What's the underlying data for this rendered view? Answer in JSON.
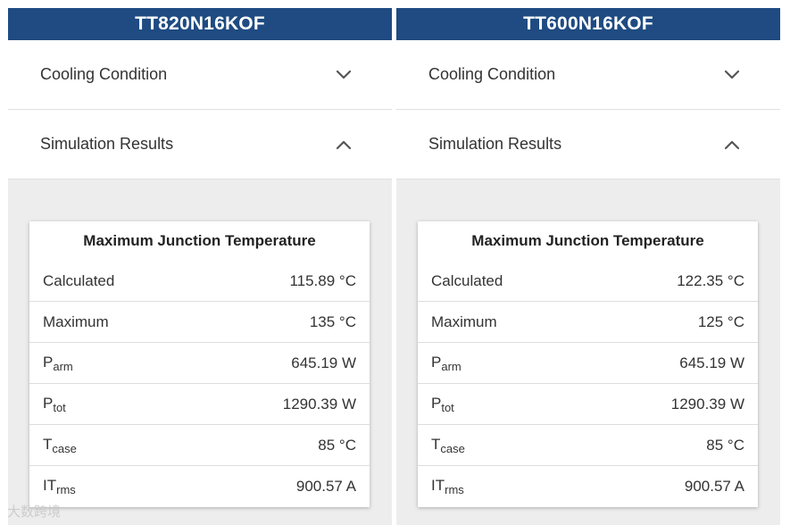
{
  "columns": [
    {
      "title": "TT820N16KOF",
      "sections": [
        {
          "label": "Cooling Condition",
          "state": "collapsed"
        },
        {
          "label": "Simulation Results",
          "state": "expanded"
        }
      ],
      "card": {
        "title": "Maximum Junction Temperature",
        "rows": [
          {
            "label": "Calculated",
            "sub": "",
            "value": "115.89 °C"
          },
          {
            "label": "Maximum",
            "sub": "",
            "value": "135 °C"
          },
          {
            "label": "P",
            "sub": "arm",
            "value": "645.19 W"
          },
          {
            "label": "P",
            "sub": "tot",
            "value": "1290.39 W"
          },
          {
            "label": "T",
            "sub": "case",
            "value": "85 °C"
          },
          {
            "label": "IT",
            "sub": "rms",
            "value": "900.57 A"
          }
        ]
      }
    },
    {
      "title": "TT600N16KOF",
      "sections": [
        {
          "label": "Cooling Condition",
          "state": "collapsed"
        },
        {
          "label": "Simulation Results",
          "state": "expanded"
        }
      ],
      "card": {
        "title": "Maximum Junction Temperature",
        "rows": [
          {
            "label": "Calculated",
            "sub": "",
            "value": "122.35 °C"
          },
          {
            "label": "Maximum",
            "sub": "",
            "value": "125 °C"
          },
          {
            "label": "P",
            "sub": "arm",
            "value": "645.19 W"
          },
          {
            "label": "P",
            "sub": "tot",
            "value": "1290.39 W"
          },
          {
            "label": "T",
            "sub": "case",
            "value": "85 °C"
          },
          {
            "label": "IT",
            "sub": "rms",
            "value": "900.57 A"
          }
        ]
      }
    }
  ],
  "watermark": "大数跨境",
  "colors": {
    "header_bg": "#1f4b82",
    "panel_bg": "#ededed",
    "chevron": "#555555"
  },
  "icons": {
    "collapsed": "chevron-down-icon",
    "expanded": "chevron-up-icon"
  }
}
